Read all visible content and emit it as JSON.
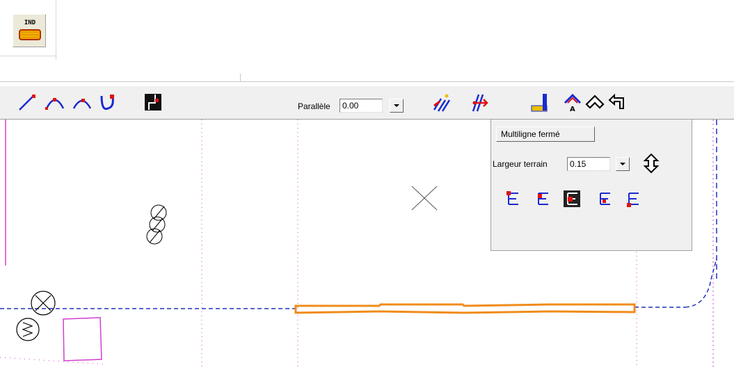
{
  "top_tile": {
    "ind_label": "IND",
    "accent": "#e8a000"
  },
  "toolbar": {
    "parallel_label": "Parallèle",
    "parallel_value": "0.00",
    "tools_left": [
      {
        "name": "line-tool-icon"
      },
      {
        "name": "arc-three-point-tool-icon"
      },
      {
        "name": "arc-tool-icon"
      },
      {
        "name": "u-curve-tool-icon"
      },
      {
        "name": "wall-tool-icon"
      }
    ],
    "tools_mid": [
      {
        "name": "parallel-offset-tool-icon"
      },
      {
        "name": "parallel-arrow-tool-icon"
      }
    ],
    "tools_right": [
      {
        "name": "corner-tool-icon"
      },
      {
        "name": "roof-a-tool-icon"
      },
      {
        "name": "chevron-tool-icon"
      },
      {
        "name": "return-arrow-tool-icon"
      }
    ]
  },
  "panel": {
    "multiline_button": "Multiligne fermé",
    "width_label": "Largeur terrain",
    "width_value": "0.15",
    "alignment_options": [
      {
        "name": "align-top-left-icon",
        "selected": false
      },
      {
        "name": "align-mid-left-icon",
        "selected": false
      },
      {
        "name": "align-center-icon",
        "selected": true
      },
      {
        "name": "align-mid-right-icon",
        "selected": false
      },
      {
        "name": "align-bottom-left-icon",
        "selected": false
      }
    ]
  },
  "colors": {
    "grid": "#d040d0",
    "axis": "#2030c0",
    "highlight": "#f08c1a",
    "tool_blue": "#1a2ad0",
    "tool_red": "#e01010"
  }
}
